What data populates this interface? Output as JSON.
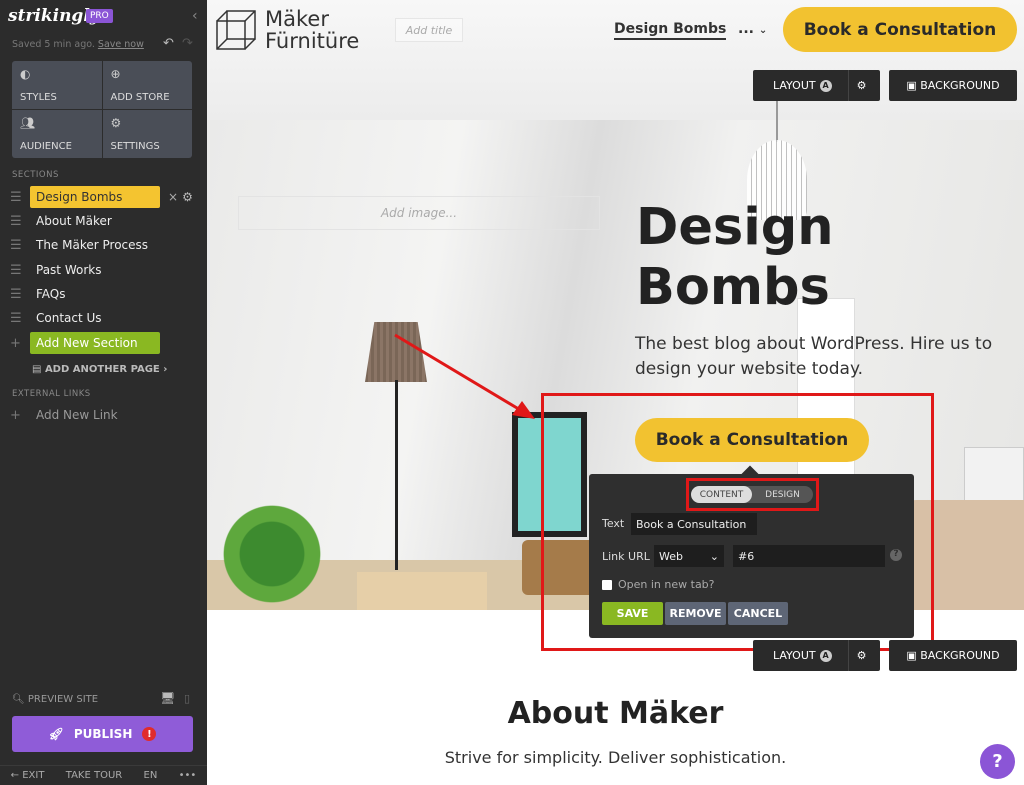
{
  "sidebar": {
    "brand": "strikingly",
    "plan_badge": "PRO",
    "saved_status": "Saved 5 min ago.",
    "save_now": "Save now",
    "tiles": [
      {
        "label": "STYLES",
        "icon": "palette-icon"
      },
      {
        "label": "ADD STORE",
        "icon": "store-bag-icon"
      },
      {
        "label": "AUDIENCE",
        "icon": "people-icon"
      },
      {
        "label": "SETTINGS",
        "icon": "gear-icon"
      }
    ],
    "sections_header": "SECTIONS",
    "sections": [
      "Design Bombs",
      "About Mäker",
      "The Mäker Process",
      "Past Works",
      "FAQs",
      "Contact Us"
    ],
    "add_section": "Add New Section",
    "add_page": "ADD ANOTHER PAGE",
    "external_header": "EXTERNAL LINKS",
    "add_link": "Add New Link",
    "preview": "PREVIEW SITE",
    "publish": "PUBLISH",
    "publish_alert": "!",
    "footer": {
      "exit": "EXIT",
      "tour": "TAKE TOUR",
      "lang": "EN",
      "more": "•••"
    },
    "colors": {
      "background": "#2c2c2c",
      "active_section": "#f4c430",
      "add_section": "#8ab822",
      "publish": "#8f5cd8"
    }
  },
  "site": {
    "logo_line1": "Mäker",
    "logo_line2": "Fürnitüre",
    "add_title": "Add title",
    "nav_link": "Design Bombs",
    "nav_more": "...",
    "header_cta": "Book a Consultation",
    "toolbar": {
      "layout": "LAYOUT",
      "layout_badge": "A",
      "background": "BACKGROUND"
    },
    "add_image": "Add image...",
    "hero_title": "Design Bombs",
    "hero_text": "The best blog about WordPress. Hire us to design your website today.",
    "hero_cta": "Book a Consultation",
    "about_title": "About Mäker",
    "about_subtitle": "Strive for simplicity. Deliver sophistication.",
    "help": "?",
    "accent_color": "#f2c230"
  },
  "popup": {
    "tabs": [
      "CONTENT",
      "DESIGN"
    ],
    "active_tab": "CONTENT",
    "text_label": "Text",
    "text_value": "Book a Consultation",
    "link_label": "Link URL",
    "link_type": "Web",
    "link_value": "#6",
    "new_tab_label": "Open in new tab?",
    "new_tab_checked": false,
    "save": "SAVE",
    "remove": "REMOVE",
    "cancel": "CANCEL"
  },
  "annotation_color": "#e01818"
}
